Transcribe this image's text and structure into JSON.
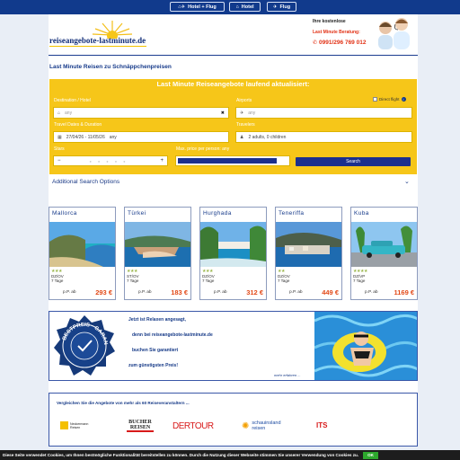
{
  "nav": {
    "buttons": [
      {
        "label": "Hotel + Flug",
        "icon": "hotel-flight-icon"
      },
      {
        "label": "Hotel",
        "icon": "hotel-icon"
      },
      {
        "label": "Flug",
        "icon": "plane-icon"
      }
    ]
  },
  "header": {
    "logo_text": "reiseangebote-lastminute.de",
    "contact_line1": "Ihre kostenlose",
    "contact_line2": "Last Minute Beratung:",
    "phone": "0991/296 769 012"
  },
  "headline": "Last Minute Reisen zu Schnäppchenpreisen",
  "search": {
    "title": "Last Minute Reiseangebote laufend aktualisiert:",
    "destination_label": "Destination / Hotel",
    "destination_placeholder": "any",
    "clear_glyph": "✖",
    "airports_label": "Airports",
    "airports_placeholder": "any",
    "direct_flight_label": "Direct flight",
    "dates_label": "Travel Dates & Duration",
    "dates_value": "27/04/26 - 11/05/26",
    "duration_value": "any",
    "travelers_label": "Travelers",
    "travelers_value": "2 adults, 0 children",
    "stars_label": "Stars",
    "stars_minus": "−",
    "stars_plus": "+",
    "max_price_label": "Max. price per person: any",
    "max_price_fill": 0.9,
    "button_label": "Search"
  },
  "additional_options_label": "Additional Search Options",
  "offers": [
    {
      "title": "Mallorca",
      "stars": "★★★",
      "board": "DZ/OV",
      "duration": "7 Tage",
      "price_label": "p.P. ab",
      "price": "293 €"
    },
    {
      "title": "Türkei",
      "stars": "★★★",
      "board": "ST/OV",
      "duration": "7 Tage",
      "price_label": "p.P. ab",
      "price": "183 €"
    },
    {
      "title": "Hurghada",
      "stars": "★★★",
      "board": "DZ/OV",
      "duration": "7 Tage",
      "price_label": "p.P. ab",
      "price": "312 €"
    },
    {
      "title": "Teneriffa",
      "stars": "★★",
      "board": "DZ/OV",
      "duration": "7 Tage",
      "price_label": "p.P. ab",
      "price": "449 €"
    },
    {
      "title": "Kuba",
      "stars": "★★★★",
      "board": "DZ/VP",
      "duration": "7 Tage",
      "price_label": "p.P. ab",
      "price": "1169 €"
    }
  ],
  "promo": {
    "line1": "Jetzt ist Relaxen angesagt,",
    "line2": "denn bei reiseangebote-lastminute.de",
    "line3": "buchen Sie garantiert",
    "line4": "zum günstigsten Preis!",
    "more": "mehr erfahren ...",
    "seal_text": "BESTPREIS · GARANTIE"
  },
  "brands": {
    "heading": "Vergleichen Sie die Angebote von mehr als 60 Reiseveranstaltern ...",
    "items": [
      "Neckermann Reisen",
      "BUCHER REISEN",
      "DERTOUR",
      "schauinsland reisen",
      "ITS"
    ]
  },
  "cookie": {
    "text": "Diese Seite verwendet Cookies, um Ihnen bestmögliche Funktionalität bereitstellen zu können. Durch die Nutzung dieser Webseite stimmen Sie unserer Verwendung von Cookies zu.",
    "ok_label": "OK"
  }
}
